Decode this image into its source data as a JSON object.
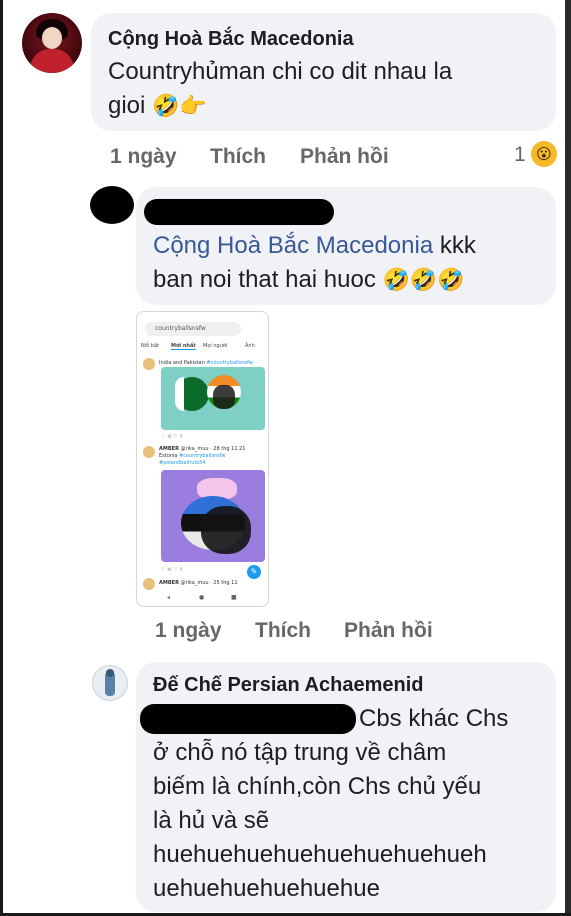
{
  "comments": [
    {
      "author": "Cộng Hoà Bắc Macedonia",
      "text_line1": "Countryhủman chi co dit nhau la",
      "text_line2": "gioi",
      "emojis": "🤣👉",
      "time": "1 ngày",
      "like_label": "Thích",
      "reply_label": "Phản hồi",
      "reaction_count": "1",
      "reaction_emoji": "😮"
    },
    {
      "mention": "Cộng Hoà Bắc Macedonia",
      "text_after_mention": " kkk",
      "text_line2": "ban noi that hai huoc",
      "emojis": "🤣🤣🤣",
      "time": "1 ngày",
      "like_label": "Thích",
      "reply_label": "Phản hồi",
      "attachment": {
        "search_text": "countryballsnsfw",
        "tabs": [
          "Nổi bật",
          "Mới nhất",
          "Mọi người",
          "Ảnh"
        ],
        "post1_caption": "India and Pakistan",
        "post1_hashtag": "#countryballsnsfw",
        "post2_user": "AMBER",
        "post2_meta": "@rika_muu · 28 thg 11 21",
        "post2_caption": "Estonia",
        "post2_hashtag": "#countryballsnsfw",
        "post2_hashtag2": "#polandballrule34",
        "post3_user": "AMBER",
        "post3_meta": "@rika_muu · 25 thg 11",
        "icon_row": "♡  ⟲  ♡  ↑"
      }
    },
    {
      "author": "Đế Chế Persian Achaemenid",
      "text_line1": "Cbs khác Chs",
      "text_line2": "ở chỗ nó tập trung về châm",
      "text_line3": "biếm là chính,còn Chs chủ yếu",
      "text_line4": "là hủ và sẽ",
      "text_line5": "huehuehuehuehuehuehuehueh",
      "text_line6": "uehuehuehuehuehue"
    }
  ],
  "colors": {
    "bubble": "#f0f2f5",
    "mention": "#385898",
    "meta": "#65676b",
    "redaction": "#000000"
  }
}
